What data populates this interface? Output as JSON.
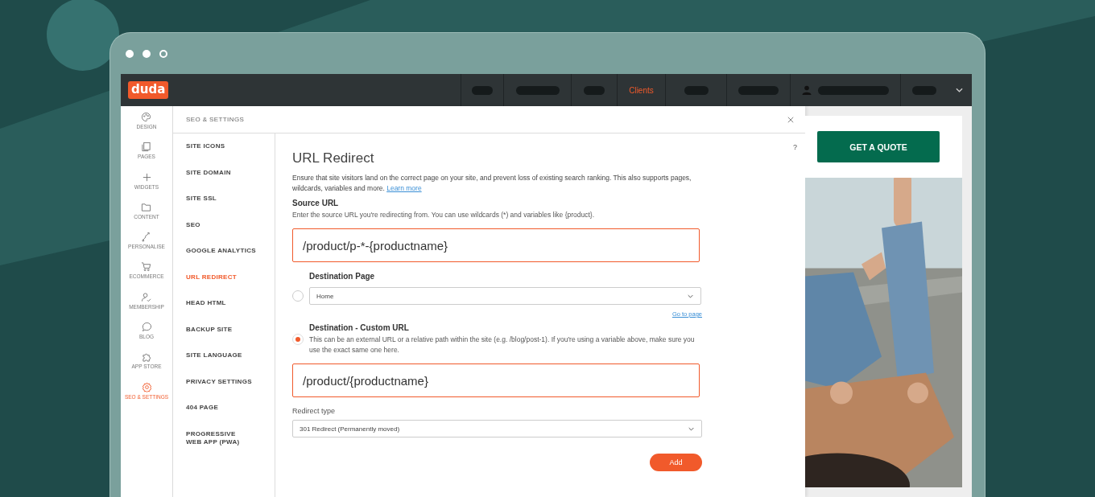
{
  "browser": {
    "dots": [
      {
        "filled": true
      },
      {
        "filled": true
      },
      {
        "filled": false
      }
    ]
  },
  "topbar": {
    "logo": "duda",
    "nav": [
      {
        "kind": "placeholder",
        "selected": false
      },
      {
        "kind": "placeholder",
        "selected": false
      },
      {
        "kind": "placeholder",
        "selected": false
      },
      {
        "kind": "label",
        "label": "Clients",
        "selected": true
      },
      {
        "kind": "placeholder",
        "selected": false
      },
      {
        "kind": "placeholder",
        "selected": false
      },
      {
        "kind": "user",
        "selected": false
      },
      {
        "kind": "placeholder",
        "selected": false
      }
    ]
  },
  "rail": [
    {
      "label": "DESIGN",
      "selected": false
    },
    {
      "label": "PAGES",
      "selected": false
    },
    {
      "label": "WIDGETS",
      "selected": false
    },
    {
      "label": "CONTENT",
      "selected": false
    },
    {
      "label": "PERSONALISE",
      "selected": false
    },
    {
      "label": "ECOMMERCE",
      "selected": false
    },
    {
      "label": "MEMBERSHIP",
      "selected": false
    },
    {
      "label": "BLOG",
      "selected": false
    },
    {
      "label": "APP STORE",
      "selected": false
    },
    {
      "label": "SEO & SETTINGS",
      "selected": true
    }
  ],
  "panel": {
    "title": "SEO & SETTINGS",
    "menu": [
      {
        "label": "SITE ICONS",
        "selected": false
      },
      {
        "label": "SITE DOMAIN",
        "selected": false
      },
      {
        "label": "SITE SSL",
        "selected": false
      },
      {
        "label": "SEO",
        "selected": false
      },
      {
        "label": "GOOGLE ANALYTICS",
        "selected": false
      },
      {
        "label": "URL REDIRECT",
        "selected": true
      },
      {
        "label": "HEAD HTML",
        "selected": false
      },
      {
        "label": "BACKUP SITE",
        "selected": false
      },
      {
        "label": "SITE LANGUAGE",
        "selected": false
      },
      {
        "label": "PRIVACY SETTINGS",
        "selected": false
      },
      {
        "label": "404 PAGE",
        "selected": false
      },
      {
        "label": "PROGRESSIVE WEB APP (PWA)",
        "selected": false
      }
    ],
    "help": "?",
    "heading": "URL Redirect",
    "intro": "Ensure that site visitors land on the correct page on your site, and prevent loss of existing search ranking. This also supports pages, wildcards, variables and more.",
    "learn_more": "Learn more",
    "source_label": "Source URL",
    "source_hint": "Enter the source URL you're redirecting from. You can use wildcards (*) and variables like {product}.",
    "source_value": "/product/p-*-{productname}",
    "destinations": [
      {
        "kind": "page",
        "title": "Destination Page",
        "selected": false,
        "value": "Home",
        "link": "Go to page"
      },
      {
        "kind": "custom",
        "title": "Destination - Custom URL",
        "selected": true,
        "hint": "This can be an external URL or a relative path within the site (e.g. /blog/post-1). If you're using a variable above, make sure you use the exact same one here.",
        "value": "/product/{productname}"
      }
    ],
    "redirect_label": "Redirect type",
    "redirect_value": "301 Redirect (Permanently moved)",
    "add": "Add"
  },
  "preview": {
    "button": "GET A QUOTE"
  }
}
